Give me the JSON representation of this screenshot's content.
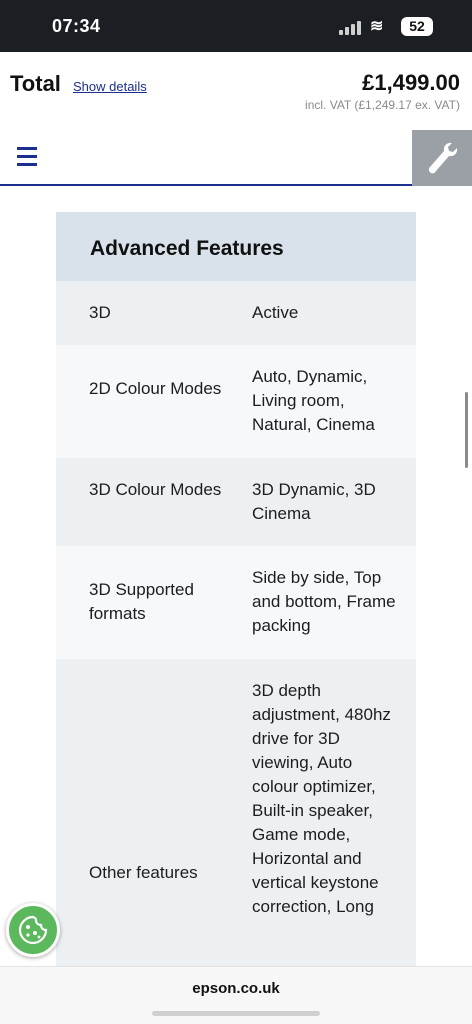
{
  "status_bar": {
    "time": "07:34",
    "battery": "52"
  },
  "header": {
    "total_label": "Total",
    "show_details": "Show details",
    "price": "£1,499.00",
    "vat_note": "incl. VAT (£1,249.17 ex. VAT)"
  },
  "section": {
    "title": "Advanced Features",
    "rows": [
      {
        "label": "3D",
        "value": "Active"
      },
      {
        "label": "2D Colour Modes",
        "value": "Auto, Dynamic, Living room, Natural, Cinema"
      },
      {
        "label": "3D Colour Modes",
        "value": "3D Dynamic, 3D Cinema"
      },
      {
        "label": "3D Supported formats",
        "value": "Side by side, Top and bottom, Frame packing"
      },
      {
        "label": "Other features",
        "value": "3D depth adjustment, 480hz drive for 3D viewing, Auto colour optimizer, Built-in speaker, Game mode, Horizontal and vertical keystone correction, Long"
      }
    ]
  },
  "browser": {
    "url": "epson.co.uk"
  },
  "colors": {
    "brand_blue": "#1a2f8f",
    "header_bg": "#d9e2ea",
    "cookie_green": "#5cb85c"
  },
  "icons": [
    "menu-icon",
    "wrench-icon",
    "cookie-icon",
    "wifi-icon",
    "signal-icon",
    "battery-icon"
  ]
}
